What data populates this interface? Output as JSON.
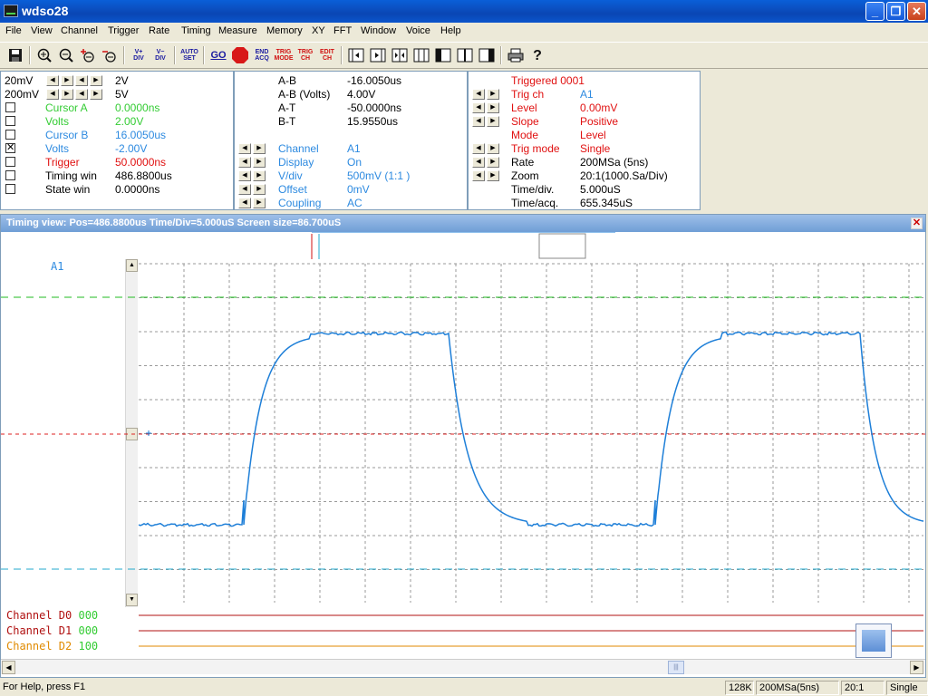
{
  "app": {
    "title": "wdso28"
  },
  "window_controls": {
    "minimize": "_",
    "restore": "❐",
    "close": "✕"
  },
  "menu": [
    "File",
    "View",
    "Channel",
    "Trigger",
    "Rate",
    "Timing",
    "Measure",
    "Memory",
    "XY",
    "FFT",
    "Window",
    "Voice",
    "Help"
  ],
  "toolbar": {
    "vplus": [
      "V+",
      "DIV"
    ],
    "vminus": [
      "V−",
      "DIV"
    ],
    "autoset": [
      "AUTO",
      "SET"
    ],
    "go": "GO",
    "stop": "STOP",
    "endacq": [
      "END",
      "ACQ"
    ],
    "trigmode": [
      "TRIG",
      "MODE"
    ],
    "trigch": [
      "TRIG",
      "CH"
    ],
    "editch": [
      "EDIT",
      "CH"
    ]
  },
  "left_panel": {
    "scale1_left": "20mV",
    "scale1_right": "2V",
    "scale2_left": "200mV",
    "scale2_right": "5V",
    "rows": [
      {
        "label": "Cursor A",
        "value": "0.0000ns",
        "color": "#33cc33",
        "checked": false
      },
      {
        "label": "Volts",
        "value": "2.00V",
        "color": "#33cc33",
        "checked": false
      },
      {
        "label": "Cursor B",
        "value": "16.0050us",
        "color": "#2d8ae0",
        "checked": false
      },
      {
        "label": "Volts",
        "value": "-2.00V",
        "color": "#2d8ae0",
        "checked": true
      },
      {
        "label": "Trigger",
        "value": "50.0000ns",
        "color": "#e01010",
        "checked": false
      },
      {
        "label": "Timing win",
        "value": "486.8800us",
        "color": "#000000",
        "checked": false
      },
      {
        "label": "State win",
        "value": "0.0000ns",
        "color": "#000000",
        "checked": false
      }
    ]
  },
  "mid_panel": {
    "measurements": [
      {
        "label": "A-B",
        "value": "-16.0050us"
      },
      {
        "label": "A-B (Volts)",
        "value": "4.00V"
      },
      {
        "label": "A-T",
        "value": "-50.0000ns"
      },
      {
        "label": "B-T",
        "value": "15.9550us"
      }
    ],
    "channel": [
      {
        "label": "Channel",
        "value": "A1"
      },
      {
        "label": "Display",
        "value": "On"
      },
      {
        "label": "V/div",
        "value": "500mV (1:1  )"
      },
      {
        "label": "Offset",
        "value": "0mV"
      },
      {
        "label": "Coupling",
        "value": "AC"
      }
    ]
  },
  "right_panel": {
    "status": "Triggered 0001",
    "rows": [
      {
        "label": "Trig ch",
        "value": "A1",
        "label_color": "#e01010",
        "value_color": "#2d8ae0",
        "arrows": true
      },
      {
        "label": "Level",
        "value": "0.00mV",
        "label_color": "#e01010",
        "value_color": "#e01010",
        "arrows": true
      },
      {
        "label": "Slope",
        "value": "Positive",
        "label_color": "#e01010",
        "value_color": "#e01010",
        "arrows": true
      },
      {
        "label": "Mode",
        "value": "Level",
        "label_color": "#e01010",
        "value_color": "#e01010",
        "arrows": false
      },
      {
        "label": "Trig mode",
        "value": "Single",
        "label_color": "#e01010",
        "value_color": "#e01010",
        "arrows": true
      },
      {
        "label": "Rate",
        "value": "200MSa (5ns)",
        "label_color": "#000000",
        "value_color": "#000000",
        "arrows": true
      },
      {
        "label": "Zoom",
        "value": "20:1(1000.Sa/Div)",
        "label_color": "#000000",
        "value_color": "#000000",
        "arrows": true
      },
      {
        "label": "Time/div.",
        "value": "5.000uS",
        "label_color": "#000000",
        "value_color": "#000000",
        "arrows": false
      },
      {
        "label": "Time/acq.",
        "value": "655.345uS",
        "label_color": "#000000",
        "value_color": "#000000",
        "arrows": false
      }
    ]
  },
  "timing_view": {
    "title": "Timing view: Pos=486.8800us Time/Div=5.000uS Screen size=86.700uS",
    "channel_label": "A1",
    "digital": [
      {
        "name": "Channel D0",
        "value": "000",
        "color": "#b01010"
      },
      {
        "name": "Channel D1",
        "value": "000",
        "color": "#b01010"
      },
      {
        "name": "Channel D2",
        "value": "100",
        "color": "#e08a00"
      }
    ]
  },
  "colors": {
    "trace": "#1e7fd8",
    "cursor_a": "#22bb22",
    "cursor_b": "#22aacc",
    "trigger": "#dd2222",
    "grid": "#9a9a9a"
  },
  "statusbar": {
    "help": "For Help, press F1",
    "mem": "128K",
    "rate": "200MSa(5ns)",
    "zoom": "20:1",
    "mode": "Single"
  }
}
